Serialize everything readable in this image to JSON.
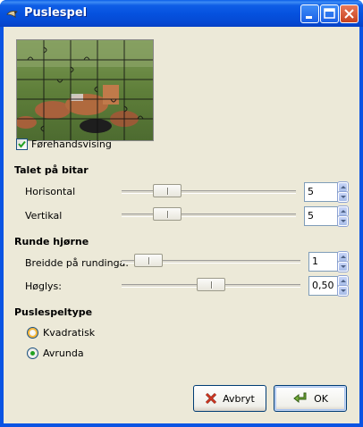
{
  "window": {
    "title": "Puslespel"
  },
  "preview": {
    "checkbox_label": "Førehandsvising",
    "checkbox_checked": true
  },
  "sections": {
    "pieces_title": "Talet på bitar",
    "corners_title": "Runde hjørne",
    "type_title": "Puslespeltype"
  },
  "pieces": {
    "horizontal": {
      "label": "Horisontal",
      "value": "5"
    },
    "vertical": {
      "label": "Vertikal",
      "value": "5"
    }
  },
  "corners": {
    "width": {
      "label": "Breidde på rundinga:",
      "value": "1"
    },
    "highlight": {
      "label": "Høglys:",
      "value": "0,50"
    }
  },
  "type": {
    "options": [
      {
        "label": "Kvadratisk",
        "selected": false
      },
      {
        "label": "Avrunda",
        "selected": true
      }
    ]
  },
  "buttons": {
    "cancel_label": "Avbryt",
    "ok_label": "OK"
  },
  "icons": {
    "title": "gimp-wilber-icon",
    "cancel": "cancel-x-icon",
    "ok": "ok-arrow-icon"
  },
  "colors": {
    "titlebar": "#0552df",
    "client": "#ece9d8",
    "radio_selected": "#21a121"
  }
}
